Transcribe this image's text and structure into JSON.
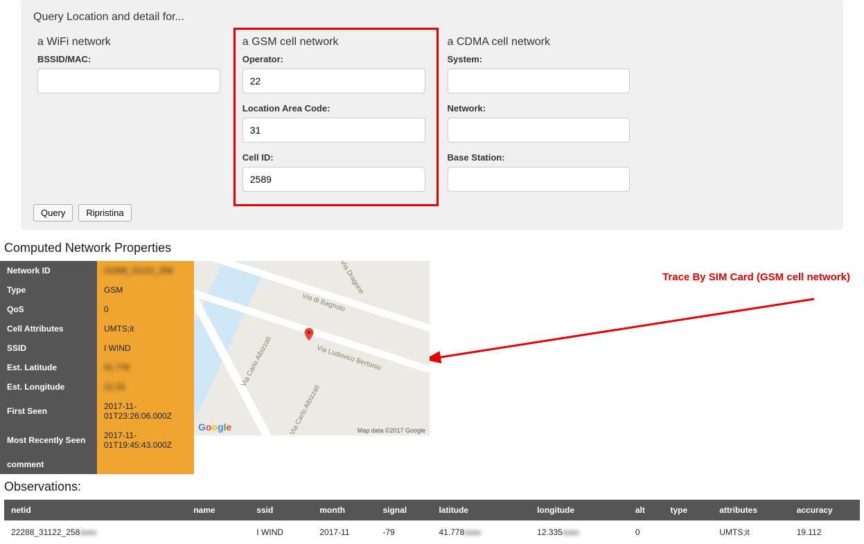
{
  "panel": {
    "title": "Query Location and detail for...",
    "wifi": {
      "heading": "a WiFi network",
      "bssid_label": "BSSID/MAC:",
      "bssid_value": ""
    },
    "gsm": {
      "heading": "a GSM cell network",
      "operator_label": "Operator:",
      "operator_value": "22",
      "lac_label": "Location Area Code:",
      "lac_value": "31",
      "cellid_label": "Cell ID:",
      "cellid_value": "2589"
    },
    "cdma": {
      "heading": "a CDMA cell network",
      "system_label": "System:",
      "system_value": "",
      "network_label": "Network:",
      "network_value": "",
      "basestation_label": "Base Station:",
      "basestation_value": ""
    },
    "query_btn": "Query",
    "reset_btn": "Ripristina"
  },
  "props_heading": "Computed Network Properties",
  "props": [
    {
      "k": "Network ID",
      "v": "22288_31122_258"
    },
    {
      "k": "Type",
      "v": "GSM"
    },
    {
      "k": "QoS",
      "v": "0"
    },
    {
      "k": "Cell Attributes",
      "v": "UMTS;it"
    },
    {
      "k": "SSID",
      "v": "I WIND"
    },
    {
      "k": "Est. Latitude",
      "v": "41.778"
    },
    {
      "k": "Est. Longitude",
      "v": "12.33"
    },
    {
      "k": "First Seen",
      "v": "2017-11-01T23:26:06.000Z"
    },
    {
      "k": "Most Recently Seen",
      "v": "2017-11-01T19:45:43.000Z"
    },
    {
      "k": "comment",
      "v": ""
    }
  ],
  "map": {
    "roads": [
      "Via Dragone",
      "Via di Bagnolo",
      "Via Carlo Albizzati",
      "Via Carlo Albizzati",
      "Via Ludovico Bertonio"
    ],
    "attr": "Map data ©2017 Google",
    "logo": "Google"
  },
  "annotation": "Trace By SIM Card (GSM cell network)",
  "obs_heading": "Observations:",
  "obs": {
    "headers": [
      "netid",
      "name",
      "ssid",
      "month",
      "signal",
      "latitude",
      "longitude",
      "alt",
      "type",
      "attributes",
      "accuracy"
    ],
    "row": {
      "netid": "22288_31122_258",
      "name": "",
      "ssid": "I WIND",
      "month": "2017-11",
      "signal": "-79",
      "latitude": "41.778",
      "longitude": "12.335",
      "alt": "0",
      "type": "",
      "attributes": "UMTS;it",
      "accuracy": "19.112"
    }
  }
}
